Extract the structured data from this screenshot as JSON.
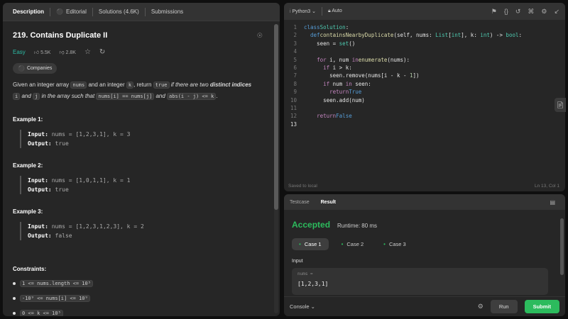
{
  "left_tabs": [
    {
      "label": "Description",
      "active": true
    },
    {
      "label": "Editorial",
      "icon": "lock-icon"
    },
    {
      "label": "Solutions (4.6K)"
    },
    {
      "label": "Submissions"
    }
  ],
  "problem": {
    "title": "219. Contains Duplicate II",
    "difficulty": "Easy",
    "likes": "5.5K",
    "dislikes": "2.8K",
    "companies_label": "Companies",
    "desc_parts": {
      "p1": "Given an integer array ",
      "nums": "nums",
      "p2": " and an integer ",
      "k": "k",
      "p3": ", return ",
      "true": "true",
      "p4": " if there are two ",
      "distinct": "distinct indices",
      "i": "i",
      "and": " and ",
      "j": "j",
      "p5": " in the array such that ",
      "eq": "nums[i] == nums[j]",
      "and2": " and ",
      "abs": "abs(i - j) <= k",
      "end": "."
    },
    "examples": [
      {
        "title": "Example 1:",
        "input_label": "Input:",
        "input": " nums = [1,2,3,1], k = 3",
        "output_label": "Output:",
        "output": " true"
      },
      {
        "title": "Example 2:",
        "input_label": "Input:",
        "input": " nums = [1,0,1,1], k = 1",
        "output_label": "Output:",
        "output": " true"
      },
      {
        "title": "Example 3:",
        "input_label": "Input:",
        "input": " nums = [1,2,3,1,2,3], k = 2",
        "output_label": "Output:",
        "output": " false"
      }
    ],
    "constraints_title": "Constraints:",
    "constraints": [
      "1 <= nums.length <= 10⁵",
      "-10⁹ <= nums[i] <= 10⁹",
      "0 <= k <= 10⁵"
    ]
  },
  "editor": {
    "language": "Python3",
    "auto_label": "Auto",
    "saved_text": "Saved to local",
    "cursor_pos": "Ln 13, Col 1"
  },
  "result": {
    "tabs": [
      "Testcase",
      "Result"
    ],
    "status": "Accepted",
    "runtime": "Runtime: 80 ms",
    "cases": [
      "Case 1",
      "Case 2",
      "Case 3"
    ],
    "input_label": "Input",
    "input_name": "nums =",
    "input_value": "[1,2,3,1]",
    "console_label": "Console",
    "run_label": "Run",
    "submit_label": "Submit"
  },
  "colors": {
    "accepted": "#2cbb5d",
    "easy": "#2cbba5",
    "lock": "#f0a020"
  }
}
